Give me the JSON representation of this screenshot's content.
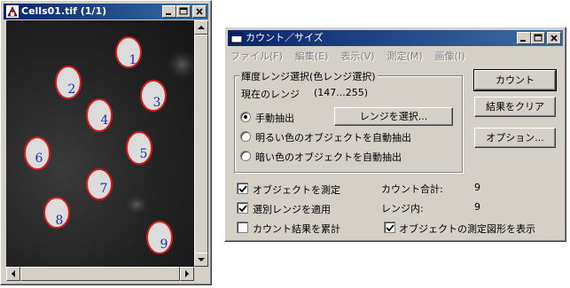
{
  "image_window": {
    "title": "Cells01.tif  (1/1)",
    "cell_labels": [
      "1",
      "2",
      "3",
      "4",
      "5",
      "6",
      "7",
      "8",
      "9"
    ]
  },
  "count_window": {
    "title": "カウント／サイズ",
    "menu": [
      "ファイル(F)",
      "編集(E)",
      "表示(V)",
      "測定(M)",
      "画像(I)"
    ],
    "group_title": "輝度レンジ選択(色レンジ選択)",
    "current_range_label": "現在のレンジ",
    "current_range_value": "(147...255)",
    "radio_options": [
      {
        "label": "手動抽出",
        "selected": true
      },
      {
        "label": "明るい色のオブジェクトを自動抽出",
        "selected": false
      },
      {
        "label": "暗い色のオブジェクトを自動抽出",
        "selected": false
      }
    ],
    "select_range_button": "レンジを選択...",
    "buttons": {
      "count": "カウント",
      "clear": "結果をクリア",
      "options": "オプション..."
    },
    "checkboxes": [
      {
        "label": "オブジェクトを測定",
        "checked": true
      },
      {
        "label": "選別レンジを適用",
        "checked": true
      },
      {
        "label": "カウント結果を累計",
        "checked": false
      },
      {
        "label": "オブジェクトの測定図形を表示",
        "checked": true
      }
    ],
    "total_count_label": "カウント合計:",
    "total_count_value": "9",
    "in_range_label": "レンジ内:",
    "in_range_value": "9"
  }
}
